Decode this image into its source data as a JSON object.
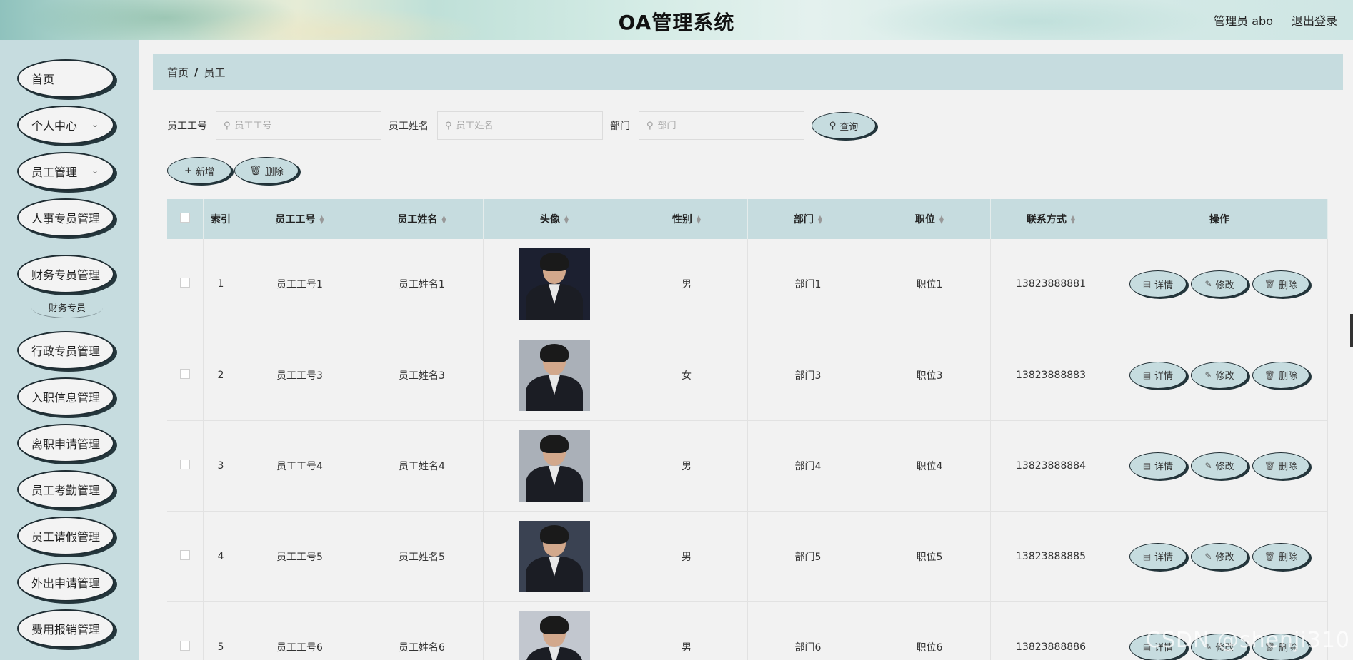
{
  "header": {
    "title": "OA管理系统",
    "user": "管理员 abo",
    "logout": "退出登录"
  },
  "sidebar": {
    "items": [
      {
        "label": "首页",
        "has_submenu": false
      },
      {
        "label": "个人中心",
        "has_submenu": true
      },
      {
        "label": "员工管理",
        "has_submenu": true
      },
      {
        "label": "人事专员管理",
        "has_submenu": false
      },
      {
        "label": "财务专员管理",
        "has_submenu": false
      },
      {
        "label": "行政专员管理",
        "has_submenu": false
      },
      {
        "label": "入职信息管理",
        "has_submenu": false
      },
      {
        "label": "离职申请管理",
        "has_submenu": false
      },
      {
        "label": "员工考勤管理",
        "has_submenu": false
      },
      {
        "label": "员工请假管理",
        "has_submenu": false
      },
      {
        "label": "外出申请管理",
        "has_submenu": false
      },
      {
        "label": "费用报销管理",
        "has_submenu": false
      }
    ],
    "submenu": {
      "label": "财务专员"
    }
  },
  "breadcrumb": {
    "home": "首页",
    "separator": "/",
    "current": "员工"
  },
  "search": {
    "id_label": "员工工号",
    "id_placeholder": "员工工号",
    "name_label": "员工姓名",
    "name_placeholder": "员工姓名",
    "dept_label": "部门",
    "dept_placeholder": "部门",
    "query_button": "查询"
  },
  "toolbar": {
    "add_label": "新增",
    "delete_label": "删除"
  },
  "table": {
    "headers": [
      "索引",
      "员工工号",
      "员工姓名",
      "头像",
      "性别",
      "部门",
      "职位",
      "联系方式",
      "操作"
    ],
    "rows": [
      {
        "index": "1",
        "emp_id": "员工工号1",
        "name": "员工姓名1",
        "gender": "男",
        "dept": "部门1",
        "position": "职位1",
        "phone": "13823888881"
      },
      {
        "index": "2",
        "emp_id": "员工工号3",
        "name": "员工姓名3",
        "gender": "女",
        "dept": "部门3",
        "position": "职位3",
        "phone": "13823888883"
      },
      {
        "index": "3",
        "emp_id": "员工工号4",
        "name": "员工姓名4",
        "gender": "男",
        "dept": "部门4",
        "position": "职位4",
        "phone": "13823888884"
      },
      {
        "index": "4",
        "emp_id": "员工工号5",
        "name": "员工姓名5",
        "gender": "男",
        "dept": "部门5",
        "position": "职位5",
        "phone": "13823888885"
      },
      {
        "index": "5",
        "emp_id": "员工工号6",
        "name": "员工姓名6",
        "gender": "男",
        "dept": "部门6",
        "position": "职位6",
        "phone": "13823888886"
      }
    ],
    "actions": {
      "detail": "详情",
      "edit": "修改",
      "delete": "删除"
    }
  },
  "watermark": "CSDN @shenji310",
  "colors": {
    "accent": "#c6dcdf",
    "sidebar_bg": "#c6dcdf",
    "page_bg": "#f2f2f2",
    "outline": "#1f2d33"
  }
}
